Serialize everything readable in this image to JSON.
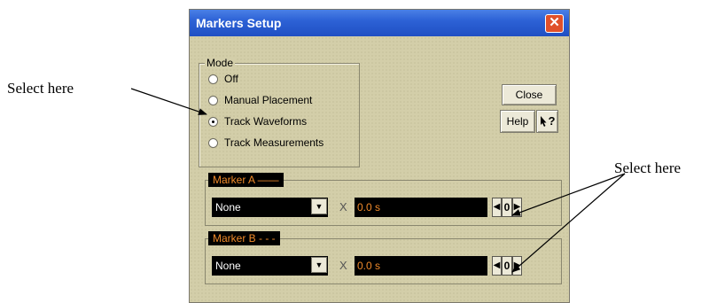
{
  "callouts": {
    "left": "Select here",
    "right": "Select here"
  },
  "window": {
    "title": "Markers Setup",
    "close_glyph": "✕"
  },
  "mode": {
    "label": "Mode",
    "options": [
      "Off",
      "Manual Placement",
      "Track Waveforms",
      "Track Measurements"
    ],
    "selected": "Track Waveforms"
  },
  "buttons": {
    "close": "Close",
    "help": "Help",
    "whats_this": "?"
  },
  "marker_a": {
    "label": "Marker A ——",
    "combo_value": "None",
    "x_label": "X",
    "value": "0.0 s",
    "spin_value": "0"
  },
  "marker_b": {
    "label": "Marker B - - -",
    "combo_value": "None",
    "x_label": "X",
    "value": "0.0 s",
    "spin_value": "0"
  },
  "icons": {
    "combo_arrow": "▼",
    "spin_left": "◀",
    "spin_right": "▶"
  },
  "colors": {
    "title_bar": "#2d62d6",
    "dialog_bg": "#d3cea9",
    "marker_text": "#f08a2a",
    "close_button": "#e0502a"
  }
}
